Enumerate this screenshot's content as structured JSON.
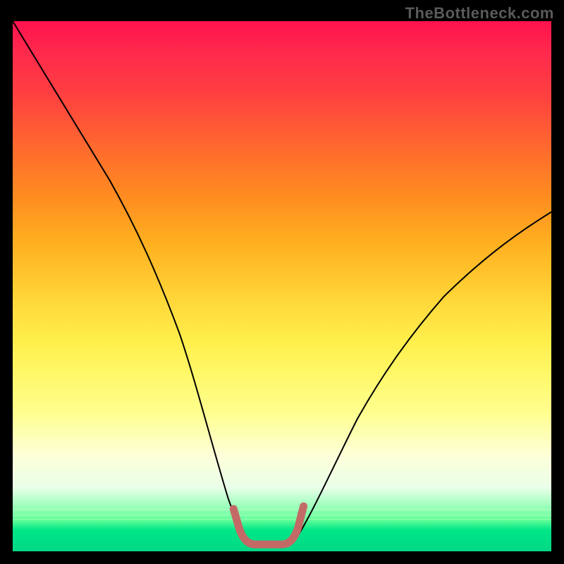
{
  "watermark": {
    "text": "TheBottleneck.com"
  },
  "chart_data": {
    "type": "line",
    "title": "",
    "xlabel": "",
    "ylabel": "",
    "xlim": [
      0,
      100
    ],
    "ylim": [
      0,
      100
    ],
    "grid": false,
    "legend": false,
    "annotations": [],
    "series": [
      {
        "name": "left-curve",
        "color": "#000000",
        "x": [
          0,
          5,
          10,
          15,
          20,
          25,
          30,
          35,
          39,
          41,
          43
        ],
        "values": [
          100,
          93,
          85,
          76,
          66,
          55,
          42,
          28,
          12,
          6,
          3
        ]
      },
      {
        "name": "bottom-bracket",
        "color": "#c86866",
        "thick": true,
        "x": [
          41,
          42,
          43,
          44,
          46,
          48,
          50,
          51,
          52,
          53,
          54
        ],
        "values": [
          8,
          4,
          2,
          1.2,
          1.2,
          1.2,
          1.2,
          2,
          4,
          6,
          9
        ]
      },
      {
        "name": "right-curve",
        "color": "#000000",
        "x": [
          53,
          55,
          58,
          62,
          66,
          70,
          75,
          80,
          85,
          90,
          95,
          100
        ],
        "values": [
          3,
          7,
          14,
          22,
          29,
          34,
          40,
          46,
          51,
          56,
          60,
          64
        ]
      }
    ],
    "notes": "Values are approximate, estimated visually from the plot; y increases upward with 0 at the green bottom and 100 at the red top."
  }
}
